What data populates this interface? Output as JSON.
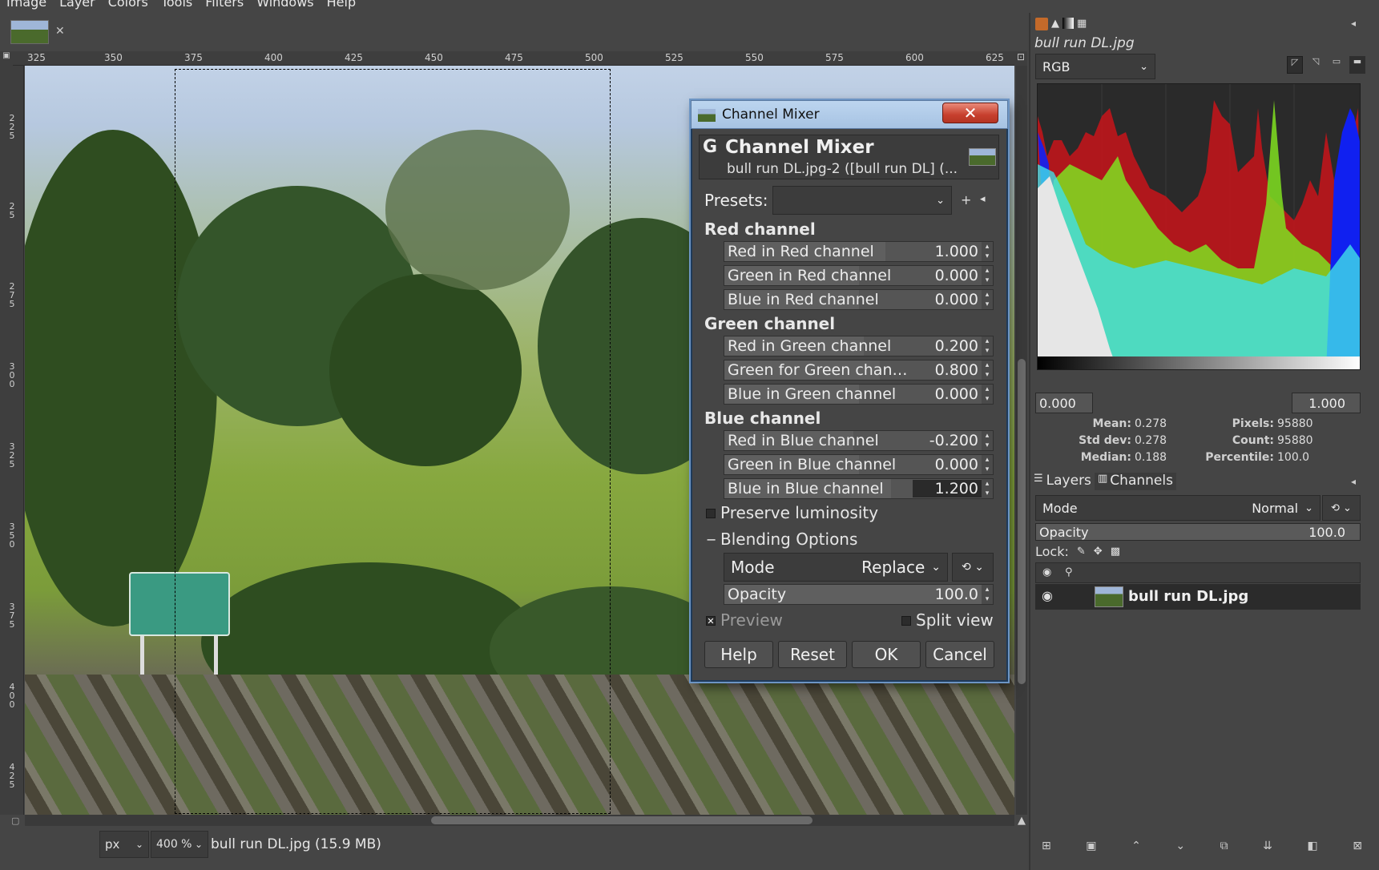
{
  "menubar": {
    "items": [
      "Image",
      "Layer",
      "Colors",
      "Tools",
      "Filters",
      "Windows",
      "Help"
    ]
  },
  "ruler": {
    "top_labels": [
      "325",
      "350",
      "375",
      "400",
      "425",
      "450",
      "475",
      "500",
      "525",
      "550",
      "575",
      "600",
      "625"
    ],
    "left_labels": [
      "2\n2\n5",
      "2\n5",
      "2\n7\n5",
      "3\n0\n0",
      "3\n2\n5",
      "3\n5\n0",
      "3\n7\n5",
      "4\n0\n0",
      "4\n2\n5"
    ]
  },
  "status": {
    "unit": "px",
    "zoom": "400 %",
    "info": "bull run DL.jpg (15.9 MB)"
  },
  "histogram": {
    "image_name": "bull run DL.jpg",
    "channel": "RGB",
    "range_low": "0.000",
    "range_high": "1.000",
    "stats": {
      "mean_label": "Mean:",
      "mean": "0.278",
      "stddev_label": "Std dev:",
      "stddev": "0.278",
      "median_label": "Median:",
      "median": "0.188",
      "pixels_label": "Pixels:",
      "pixels": "95880",
      "count_label": "Count:",
      "count": "95880",
      "percentile_label": "Percentile:",
      "percentile": "100.0"
    }
  },
  "layers_panel": {
    "tab_layers": "Layers",
    "tab_channels": "Channels",
    "mode_label": "Mode",
    "mode_value": "Normal",
    "opacity_label": "Opacity",
    "opacity_value": "100.0",
    "lock_label": "Lock:",
    "layer_name": "bull run DL.jpg"
  },
  "dialog": {
    "window_title": "Channel Mixer",
    "header_title": "Channel Mixer",
    "header_subtitle": "bull run DL.jpg-2 ([bull run DL] (...",
    "presets_label": "Presets:",
    "sections": [
      {
        "title": "Red channel",
        "rows": [
          {
            "label": "Red in Red channel",
            "value": "1.000",
            "fill": 0.6
          },
          {
            "label": "Green in Red channel",
            "value": "0.000",
            "fill": 0.5
          },
          {
            "label": "Blue in Red channel",
            "value": "0.000",
            "fill": 0.5
          }
        ]
      },
      {
        "title": "Green channel",
        "rows": [
          {
            "label": "Red in Green channel",
            "value": "0.200",
            "fill": 0.52
          },
          {
            "label": "Green for Green chan…",
            "value": "0.800",
            "fill": 0.58
          },
          {
            "label": "Blue in Green channel",
            "value": "0.000",
            "fill": 0.5
          }
        ]
      },
      {
        "title": "Blue channel",
        "rows": [
          {
            "label": "Red in Blue channel",
            "value": "-0.200",
            "fill": 0.48
          },
          {
            "label": "Green in Blue channel",
            "value": "0.000",
            "fill": 0.5
          },
          {
            "label": "Blue in Blue channel",
            "value": "1.200",
            "fill": 0.62
          }
        ]
      }
    ],
    "preserve_luminosity": "Preserve luminosity",
    "blending_options": "Blending Options",
    "blend_mode_label": "Mode",
    "blend_mode_value": "Replace",
    "blend_opacity_label": "Opacity",
    "blend_opacity_value": "100.0",
    "preview_label": "Preview",
    "split_view_label": "Split view",
    "buttons": {
      "help": "Help",
      "reset": "Reset",
      "ok": "OK",
      "cancel": "Cancel"
    }
  }
}
